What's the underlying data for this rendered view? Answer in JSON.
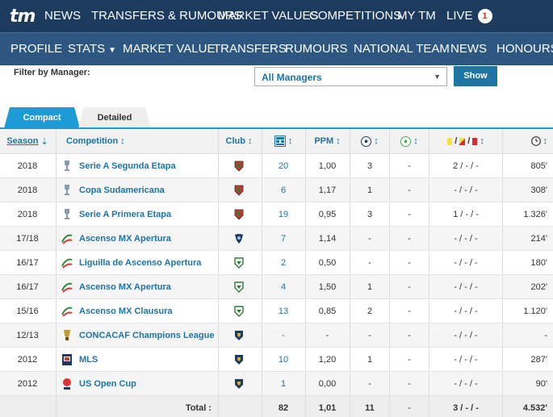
{
  "topnav": {
    "logo": "tm",
    "items": [
      "NEWS",
      "TRANSFERS & RUMOURS",
      "MARKET VALUES",
      "COMPETITIONS",
      "MY TM",
      "LIVE"
    ],
    "live_count": "1"
  },
  "subnav": {
    "items": [
      "PROFILE",
      "STATS",
      "MARKET VALUE",
      "TRANSFERS",
      "RUMOURS",
      "NATIONAL TEAM",
      "NEWS",
      "HONOURS"
    ]
  },
  "filter": {
    "label": "Filter by Manager:",
    "selected": "All Managers",
    "button": "Show"
  },
  "tabs": {
    "compact": "Compact",
    "detailed": "Detailed"
  },
  "table": {
    "headers": {
      "season": "Season",
      "competition": "Competition",
      "club": "Club",
      "ppm": "PPM"
    },
    "rows": [
      {
        "season": "2018",
        "competition": "Serie A Segunda Etapa",
        "apps": "20",
        "ppm": "1,00",
        "goals": "3",
        "assists": "-",
        "cards": "2 / - / -",
        "minutes": "805'",
        "comp_icon": "trophy-icon",
        "club_icon": "crest-red-icon"
      },
      {
        "season": "2018",
        "competition": "Copa Sudamericana",
        "apps": "6",
        "ppm": "1,17",
        "goals": "1",
        "assists": "-",
        "cards": "- / - / -",
        "minutes": "308'",
        "comp_icon": "trophy-icon",
        "club_icon": "crest-red-icon"
      },
      {
        "season": "2018",
        "competition": "Serie A Primera Etapa",
        "apps": "19",
        "ppm": "0,95",
        "goals": "3",
        "assists": "-",
        "cards": "1 / - / -",
        "minutes": "1.326'",
        "comp_icon": "trophy-icon",
        "club_icon": "crest-red-icon"
      },
      {
        "season": "17/18",
        "competition": "Ascenso MX Apertura",
        "apps": "7",
        "ppm": "1,14",
        "goals": "-",
        "assists": "-",
        "cards": "- / - / -",
        "minutes": "214'",
        "comp_icon": "ascenso-mx-icon",
        "club_icon": "crest-blue-icon"
      },
      {
        "season": "16/17",
        "competition": "Liguilla de Ascenso Apertura",
        "apps": "2",
        "ppm": "0,50",
        "goals": "-",
        "assists": "-",
        "cards": "- / - / -",
        "minutes": "180'",
        "comp_icon": "ascenso-mx-icon",
        "club_icon": "crest-green-icon"
      },
      {
        "season": "16/17",
        "competition": "Ascenso MX Apertura",
        "apps": "4",
        "ppm": "1,50",
        "goals": "1",
        "assists": "-",
        "cards": "- / - / -",
        "minutes": "202'",
        "comp_icon": "ascenso-mx-icon",
        "club_icon": "crest-green-icon"
      },
      {
        "season": "15/16",
        "competition": "Ascenso MX Clausura",
        "apps": "13",
        "ppm": "0,85",
        "goals": "2",
        "assists": "-",
        "cards": "- / - / -",
        "minutes": "1.120'",
        "comp_icon": "ascenso-mx-icon",
        "club_icon": "crest-green-icon"
      },
      {
        "season": "12/13",
        "competition": "CONCACAF Champions League",
        "apps": "-",
        "ppm": "-",
        "goals": "-",
        "assists": "-",
        "cards": "- / - / -",
        "minutes": "-",
        "comp_icon": "concacaf-icon",
        "club_icon": "crest-navy-icon"
      },
      {
        "season": "2012",
        "competition": "MLS",
        "apps": "10",
        "ppm": "1,20",
        "goals": "1",
        "assists": "-",
        "cards": "- / - / -",
        "minutes": "287'",
        "comp_icon": "mls-icon",
        "club_icon": "crest-navy-icon"
      },
      {
        "season": "2012",
        "competition": "US Open Cup",
        "apps": "1",
        "ppm": "0,00",
        "goals": "-",
        "assists": "-",
        "cards": "- / - / -",
        "minutes": "90'",
        "comp_icon": "us-open-cup-icon",
        "club_icon": "crest-navy-icon"
      }
    ],
    "totals": {
      "label": "Total :",
      "apps": "82",
      "ppm": "1,01",
      "goals": "11",
      "assists": "-",
      "cards": "3 / - / -",
      "minutes": "4.532'"
    }
  },
  "colors": {
    "topnav_bg": "#1d3a5f",
    "subnav_bg": "#2d5780",
    "link": "#1d75a3",
    "tab_active": "#1d9bd6"
  }
}
